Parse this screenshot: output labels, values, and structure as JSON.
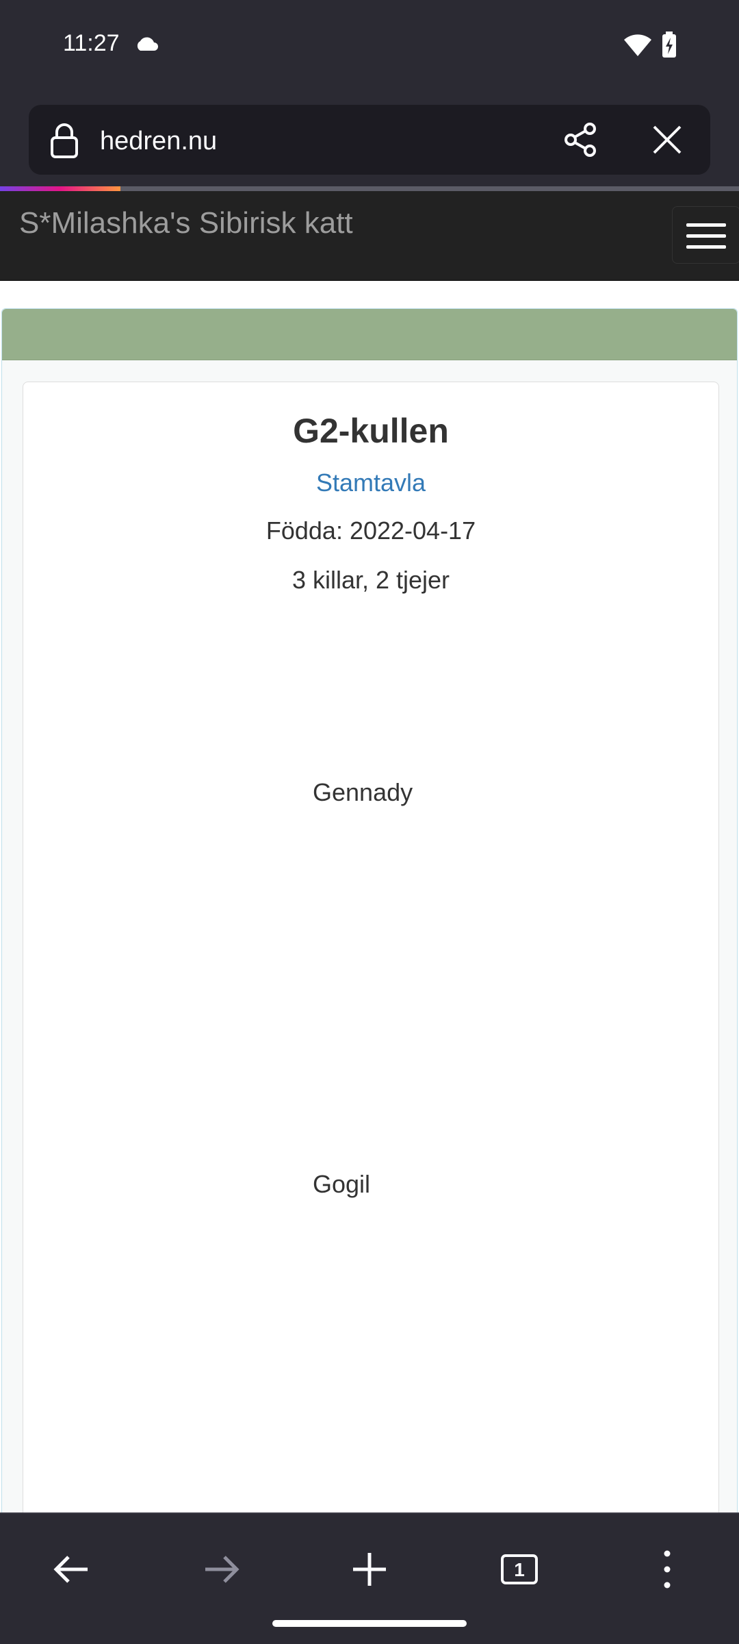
{
  "status_bar": {
    "time": "11:27",
    "icons": [
      "cloud-icon",
      "wifi-icon",
      "battery-charging-icon"
    ]
  },
  "browser": {
    "url": "hedren.nu",
    "page_load_progress": 0.25,
    "icons": [
      "lock-icon",
      "share-icon",
      "close-icon"
    ]
  },
  "site_header": {
    "brand": "S*Milashka's Sibirisk katt",
    "menu_icon": "hamburger-menu-icon"
  },
  "litter": {
    "title": "G2-kullen",
    "pedigree_link": "Stamtavla",
    "born": "Födda: 2022-04-17",
    "count": "3 killar, 2 tjejer",
    "kittens": [
      "Gennady",
      "Gogil"
    ]
  },
  "bottom_nav": {
    "tab_count": "1",
    "icons": [
      "back-arrow-icon",
      "forward-arrow-icon",
      "new-tab-plus-icon",
      "tabs-counter-icon",
      "overflow-menu-icon"
    ]
  },
  "colors": {
    "chrome_background": "#2b2a33",
    "url_bar_background": "#1c1b22",
    "site_header_background": "#222222",
    "panel_heading": "#96af8b",
    "link": "#337ab7"
  }
}
